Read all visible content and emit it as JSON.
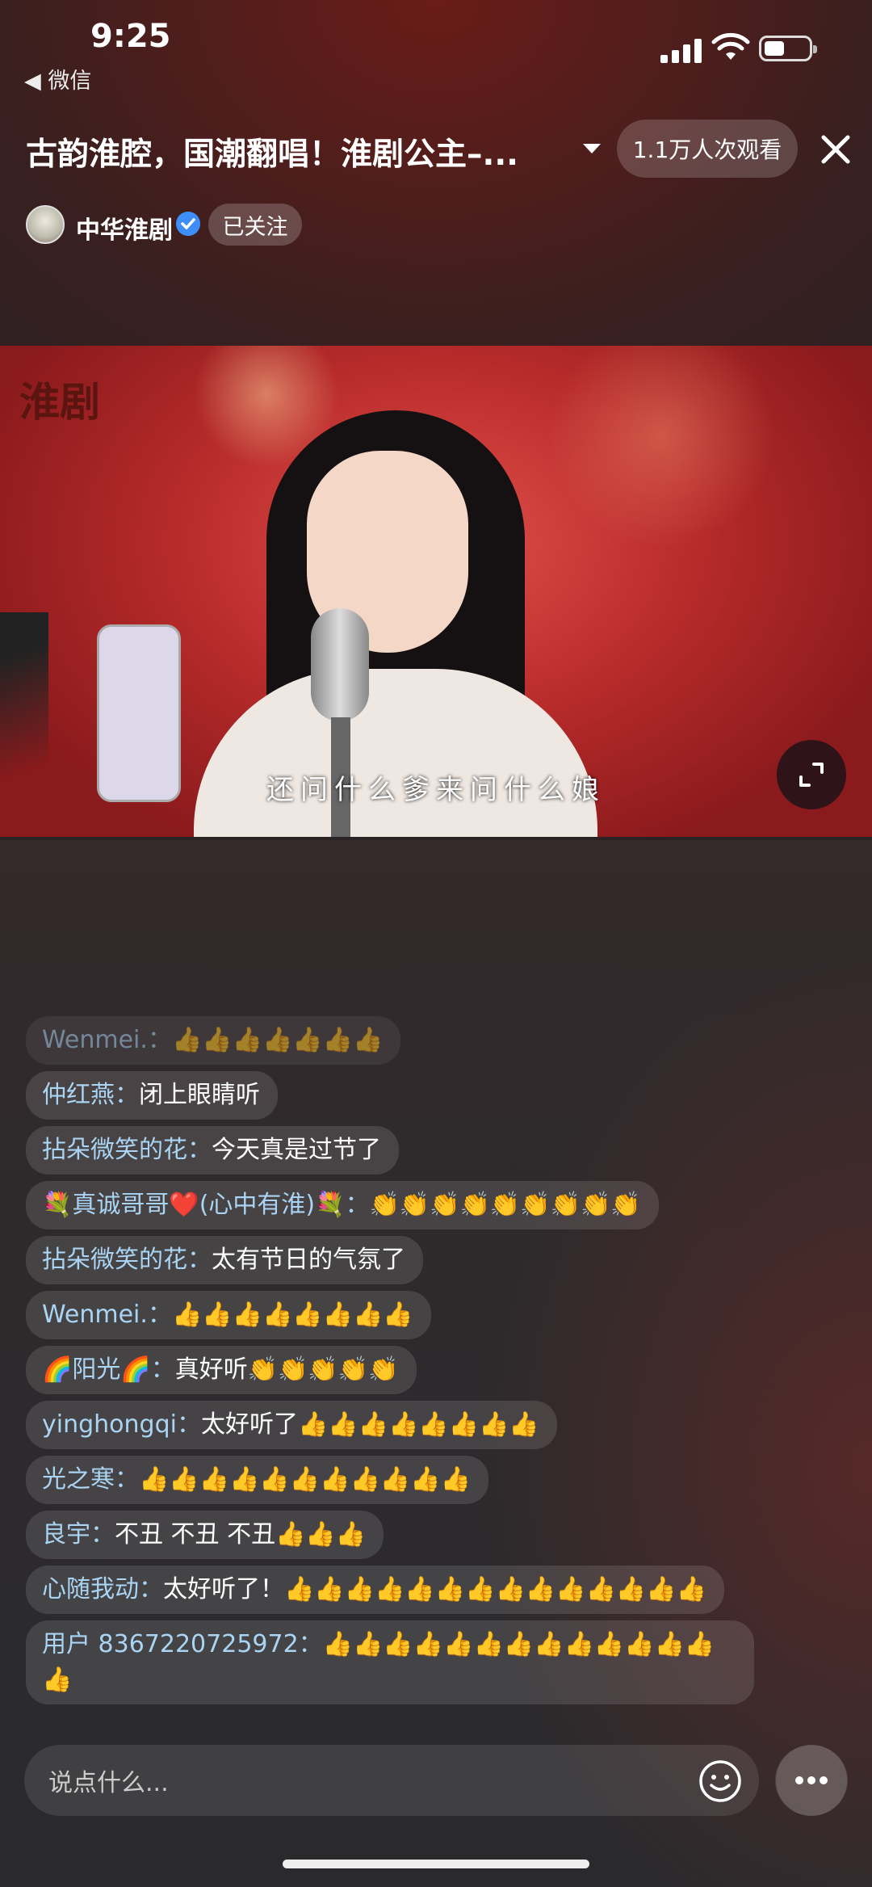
{
  "status_bar": {
    "time": "9:25",
    "back_app": "◀ 微信"
  },
  "header": {
    "title": "古韵淮腔，国潮翻唱！淮剧公主–...",
    "views": "1.1万人次观看",
    "channel_name": "中华淮剧",
    "follow_label": "已关注"
  },
  "video": {
    "logo_text": "淮剧",
    "subtitle": "还问什么爹来问什么娘",
    "fullscreen_icon": "expand-icon"
  },
  "chat": [
    {
      "user": "Wenmei.：",
      "text": "👍👍👍👍👍👍👍",
      "faded": true
    },
    {
      "user": "仲红燕：",
      "text": "闭上眼睛听"
    },
    {
      "user": "拈朵微笑的花：",
      "text": "今天真是过节了"
    },
    {
      "user": "💐真诚哥哥❤️(心中有淮)💐：",
      "text": "👏👏👏👏👏👏👏👏👏"
    },
    {
      "user": "拈朵微笑的花：",
      "text": "太有节日的气氛了"
    },
    {
      "user": "Wenmei.：",
      "text": "👍👍👍👍👍👍👍👍"
    },
    {
      "user": "🌈阳光🌈：",
      "text": "真好听👏👏👏👏👏"
    },
    {
      "user": "yinghongqi：",
      "text": "太好听了👍👍👍👍👍👍👍👍"
    },
    {
      "user": "光之寒：",
      "text": "👍👍👍👍👍👍👍👍👍👍👍"
    },
    {
      "user": "良宇：",
      "text": "不丑 不丑 不丑👍👍👍"
    },
    {
      "user": "心随我动：",
      "text": "太好听了！👍👍👍👍👍👍👍👍👍👍👍👍👍👍"
    },
    {
      "user": "用户 8367220725972：",
      "text": "👍👍👍👍👍👍👍👍👍👍👍👍👍👍"
    }
  ],
  "input": {
    "placeholder": "说点什么..."
  },
  "colors": {
    "username": "#a9d4f3",
    "verified": "#3d8ef6"
  }
}
